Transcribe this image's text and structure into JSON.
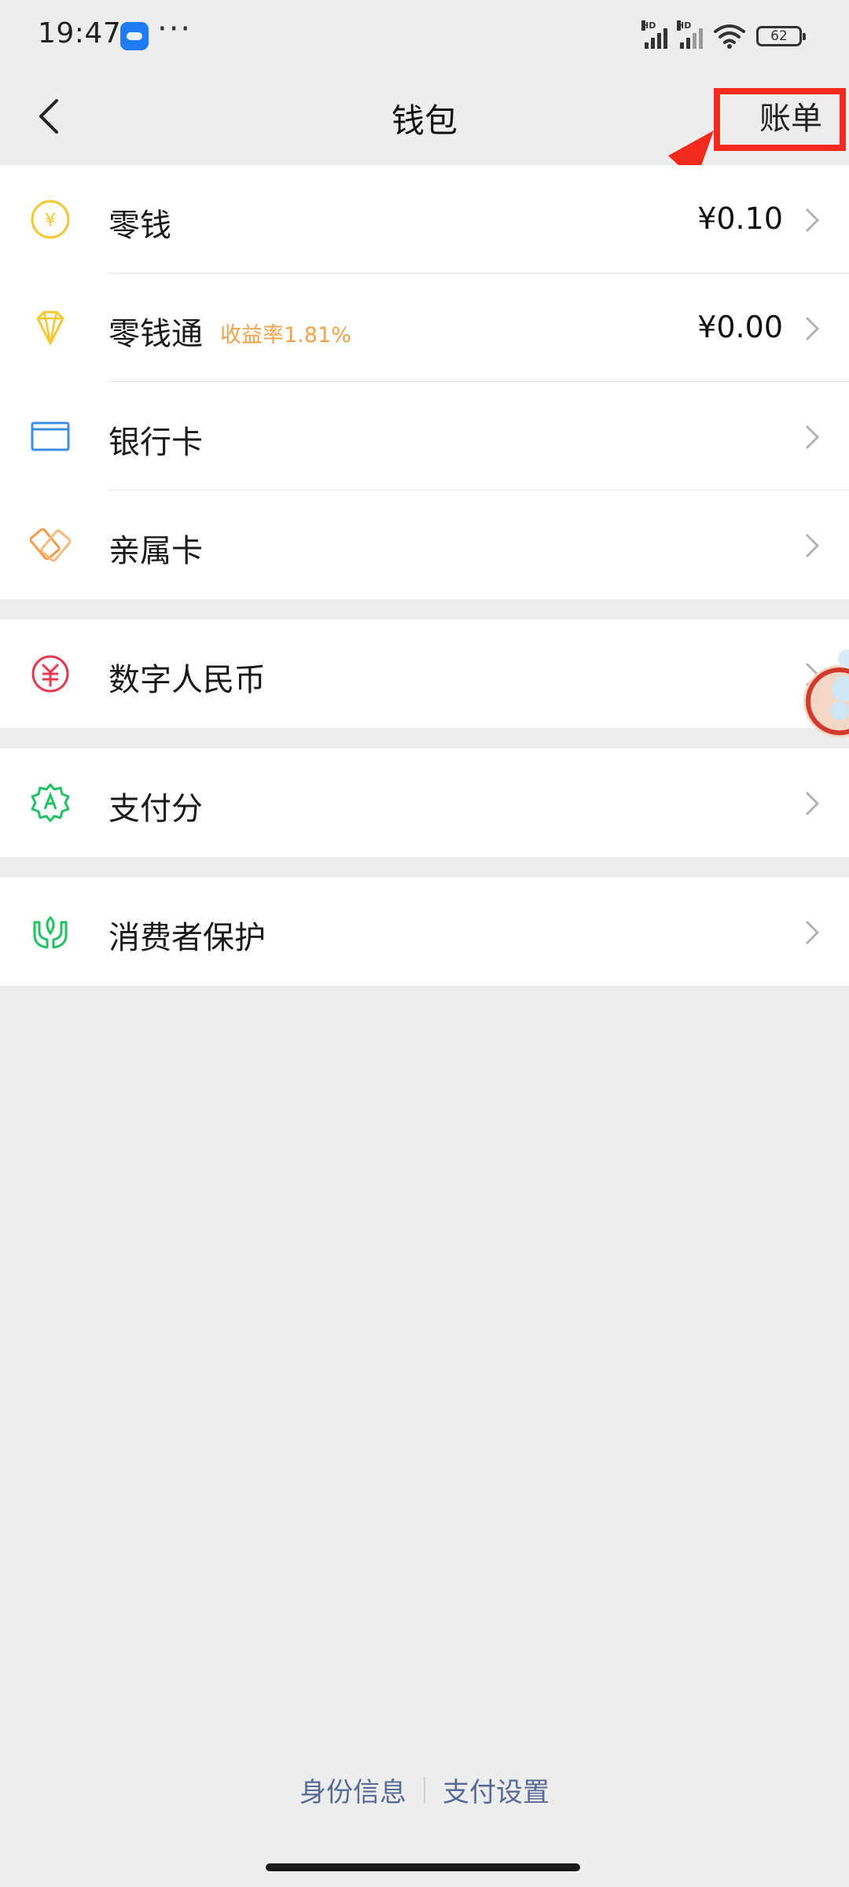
{
  "status_bar": {
    "time": "19:47",
    "more": "···",
    "battery": "62"
  },
  "nav": {
    "title": "钱包",
    "right_action": "账单"
  },
  "groups": [
    {
      "items": [
        {
          "label": "零钱",
          "tag": "",
          "value": "¥0.10",
          "icon": "coin-icon",
          "color": "#f7c633"
        },
        {
          "label": "零钱通",
          "tag": "收益率1.81%",
          "value": "¥0.00",
          "icon": "diamond-icon",
          "color": "#f7c633"
        },
        {
          "label": "银行卡",
          "tag": "",
          "value": "",
          "icon": "bank-card-icon",
          "color": "#3d8ee0"
        },
        {
          "label": "亲属卡",
          "tag": "",
          "value": "",
          "icon": "family-card-icon",
          "color": "#f59a4a"
        }
      ]
    },
    {
      "items": [
        {
          "label": "数字人民币",
          "icon": "digital-rmb-icon",
          "color": "#e8384f"
        }
      ]
    },
    {
      "items": [
        {
          "label": "支付分",
          "icon": "pay-score-icon",
          "color": "#21c262"
        }
      ]
    },
    {
      "items": [
        {
          "label": "消费者保护",
          "icon": "consumer-protection-icon",
          "color": "#21c262"
        }
      ]
    }
  ],
  "footer": {
    "identity": "身份信息",
    "settings": "支付设置"
  },
  "colors": {
    "background": "#ededed",
    "annotation": "#f02a1d",
    "link": "#576b95"
  }
}
